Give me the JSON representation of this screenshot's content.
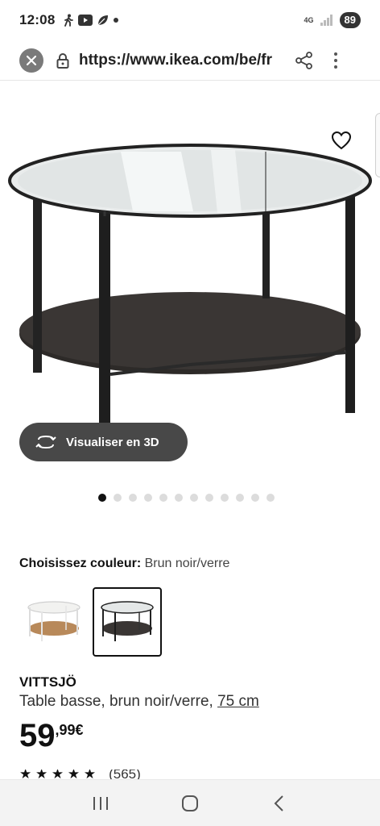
{
  "status_bar": {
    "time": "12:08",
    "network": "4G",
    "battery": "89",
    "icons": [
      "person-walking-icon",
      "youtube-icon",
      "leaf-icon",
      "dot-icon",
      "signal-icon"
    ]
  },
  "browser": {
    "url": "https://www.ikea.com/be/fr",
    "icons": [
      "close-icon",
      "lock-icon",
      "share-icon",
      "more-vert-icon"
    ]
  },
  "product_image": {
    "favorite_icon": "heart-icon",
    "visualize_label": "Visualiser en 3D",
    "visualize_icon": "rotate-3d-icon",
    "carousel": {
      "total": 12,
      "active_index": 0
    }
  },
  "color_chooser": {
    "label": "Choisissez couleur:",
    "value": "Brun noir/verre",
    "options": [
      {
        "name": "white-stain-oak",
        "selected": false
      },
      {
        "name": "brun-noir-verre",
        "selected": true
      }
    ]
  },
  "product": {
    "name": "VITTSJÖ",
    "description": "Table basse, brun noir/verre, ",
    "size": "75 cm",
    "price_integer": "59",
    "price_decimal": ",99€",
    "rating_stars": 5,
    "review_count": "(565)"
  },
  "nav_bar": {
    "icons": [
      "recent-apps-icon",
      "home-icon",
      "back-icon"
    ]
  }
}
